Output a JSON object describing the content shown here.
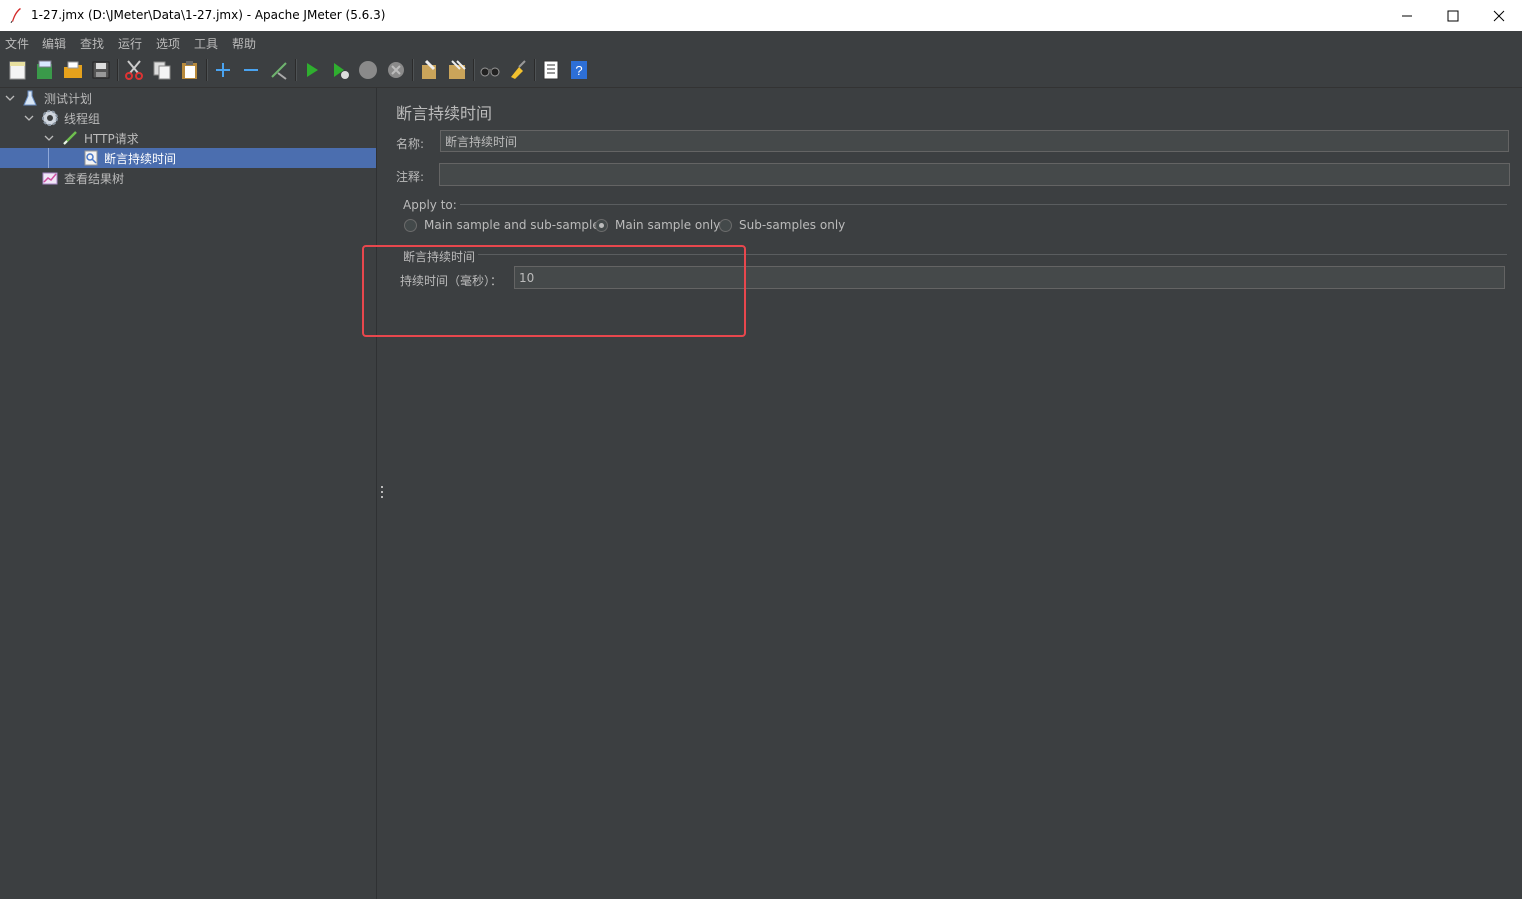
{
  "window": {
    "title": "1-27.jmx (D:\\JMeter\\Data\\1-27.jmx) - Apache JMeter (5.6.3)"
  },
  "menu": [
    "文件",
    "编辑",
    "查找",
    "运行",
    "选项",
    "工具",
    "帮助"
  ],
  "toolbar": {
    "icons": [
      "new-icon",
      "templates-icon",
      "open-icon",
      "save-icon",
      "cut-icon",
      "copy-icon",
      "paste-icon",
      "expand-icon",
      "collapse-icon",
      "toggle-icon",
      "start-icon",
      "start-no-pause-icon",
      "stop-icon",
      "shutdown-icon",
      "clear-icon",
      "clear-all-icon",
      "search-icon",
      "reset-search-icon",
      "function-helper-icon",
      "help-icon"
    ]
  },
  "tree": {
    "items": [
      {
        "label": "测试计划",
        "icon": "test-plan-icon",
        "level": 0,
        "expanded": true
      },
      {
        "label": "线程组",
        "icon": "thread-group-icon",
        "level": 1,
        "expanded": true
      },
      {
        "label": "HTTP请求",
        "icon": "http-sampler-icon",
        "level": 2,
        "expanded": true
      },
      {
        "label": "断言持续时间",
        "icon": "assertion-icon",
        "level": 3,
        "selected": true
      },
      {
        "label": "查看结果树",
        "icon": "listener-icon",
        "level": 1
      }
    ]
  },
  "panel": {
    "title": "断言持续时间",
    "name_label": "名称:",
    "name_value": "断言持续时间",
    "comment_label": "注释:",
    "comment_value": "",
    "apply_to": {
      "title": "Apply to:",
      "options": [
        "Main sample and sub-samples",
        "Main sample only",
        "Sub-samples only"
      ],
      "selected": "Main sample only"
    },
    "duration_group": {
      "title": "断言持续时间",
      "label": "持续时间（毫秒）：",
      "value": "10"
    }
  },
  "colors": {
    "background": "#3c3f41",
    "selection": "#4b6eaf",
    "highlight": "#e8474d"
  }
}
